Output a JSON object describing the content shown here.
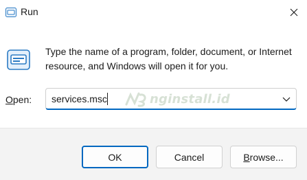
{
  "window": {
    "title": "Run",
    "title_icon": "run-icon",
    "close_icon": "close-icon"
  },
  "content": {
    "icon": "run-large-icon",
    "description": "Type the name of a program, folder, document, or Internet resource, and Windows will open it for you.",
    "open_label_accel": "O",
    "open_label_rest": "pen:",
    "input_value": "services.msc",
    "dropdown_icon": "chevron-down-icon"
  },
  "watermark": {
    "text": "nginstall.id"
  },
  "buttons": {
    "ok": "OK",
    "cancel": "Cancel",
    "browse_accel": "B",
    "browse_rest": "rowse..."
  },
  "colors": {
    "accent": "#0067c0",
    "footer_bg": "#f3f3f3"
  }
}
